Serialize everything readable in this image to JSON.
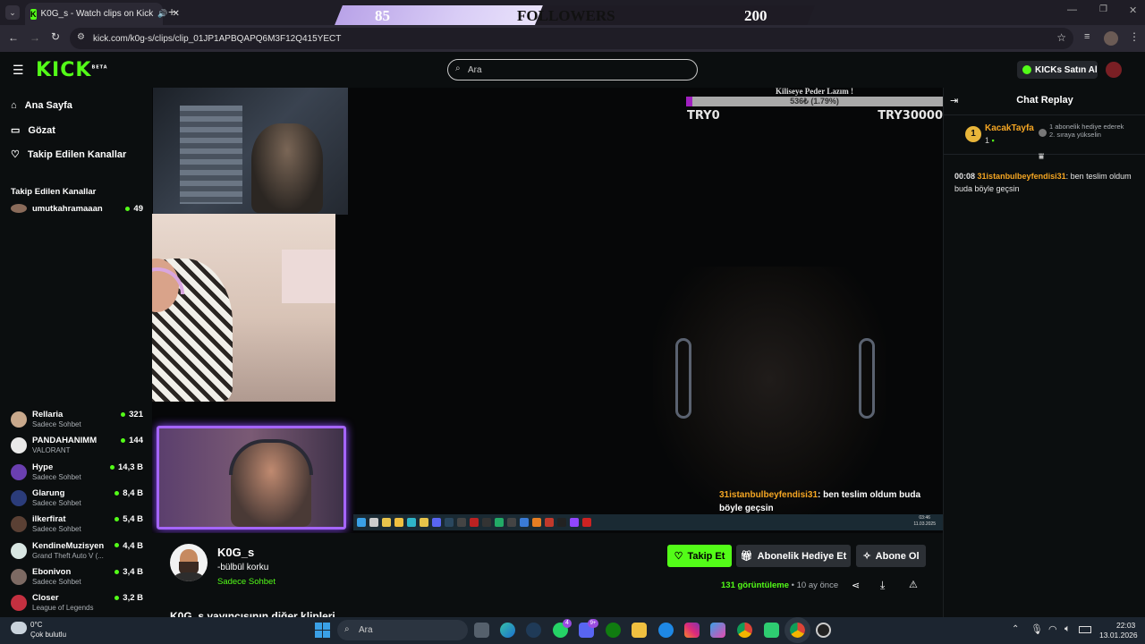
{
  "browser": {
    "tab_title": "K0G_s - Watch clips on Kick",
    "url": "kick.com/k0g-s/clips/clip_01JP1APBQAPQ6M3F12Q415YECT"
  },
  "followers_goal": {
    "current": "85",
    "label": "FOLLOWERS",
    "target": "200",
    "progress_fraction": 0.425
  },
  "header": {
    "logo": "KICK",
    "logo_badge": "BETA",
    "search_placeholder": "Ara",
    "kicks_button": "KICKs Satın Al"
  },
  "sidebar": {
    "nav": [
      {
        "label": "Ana Sayfa",
        "icon": "home-icon"
      },
      {
        "label": "Gözat",
        "icon": "browse-icon"
      },
      {
        "label": "Takip Edilen Kanallar",
        "icon": "heart-icon"
      }
    ],
    "followed_heading": "Takip Edilen Kanallar",
    "first_channel": {
      "name": "umutkahramaaan",
      "viewers": "49"
    },
    "channels": [
      {
        "name": "Rellaria",
        "category": "Sadece Sohbet",
        "viewers": "321",
        "color": "#c9a98c"
      },
      {
        "name": "PANDAHANIMM",
        "category": "VALORANT",
        "viewers": "144",
        "color": "#e9e9e9"
      },
      {
        "name": "Hype",
        "category": "Sadece Sohbet",
        "viewers": "14,3 B",
        "color": "#6a3fb0"
      },
      {
        "name": "Glarung",
        "category": "Sadece Sohbet",
        "viewers": "8,4 B",
        "color": "#2b3c7a"
      },
      {
        "name": "ilkerfirat",
        "category": "Sadece Sohbet",
        "viewers": "5,4 B",
        "color": "#5a4034"
      },
      {
        "name": "KendineMuzisyen",
        "category": "Grand Theft Auto V (...",
        "viewers": "4,4 B",
        "color": "#d8e6e2"
      },
      {
        "name": "Ebonivon",
        "category": "Sadece Sohbet",
        "viewers": "3,4 B",
        "color": "#7d6a63"
      },
      {
        "name": "Closer",
        "category": "League of Legends",
        "viewers": "3,2 B",
        "color": "#c43040"
      }
    ]
  },
  "stream_overlay": {
    "donation_title": "Kiliseye Peder Lazım !",
    "donation_value": "536₺ (1.79%)",
    "donation_fraction": 0.0179,
    "donation_min": "TRY0",
    "donation_max": "TRY30000",
    "chat_user": "31istanbulbeyfendisi31",
    "chat_message": ": ben teslim oldum buda böyle geçsin",
    "inner_clock_time": "03:46",
    "inner_clock_date": "11.03.2025"
  },
  "chat_panel": {
    "title": "Chat Replay",
    "gifter_rank": "1",
    "gifter_name": "KacakTayfa",
    "gifter_count": "1",
    "gifter_note": "1 abonelik hediye ederek 2. sıraya yükselin",
    "messages": [
      {
        "time": "00:08",
        "user": "31istanbulbeyfendisi31",
        "text": ": ben teslim oldum buda böyle geçsin"
      }
    ]
  },
  "channel_info": {
    "name": "K0G_s",
    "title": "-bülbül korku",
    "category": "Sadece Sohbet",
    "follow_button": "Takip Et",
    "gift_button": "Abonelik Hediye Et",
    "subscribe_button": "Abone Ol",
    "views_count": "131",
    "views_label": "görüntüleme",
    "age": "10 ay önce",
    "more_clips": "K0G_s yayıncısının diğer klipleri"
  },
  "taskbar": {
    "weather_temp": "0°C",
    "weather_desc": "Çok bulutlu",
    "search": "Ara",
    "time": "22:03",
    "date": "13.01.2026",
    "badge_whatsapp": "4",
    "badge_discord": "9+"
  },
  "colors": {
    "kick_green": "#53fc18",
    "username_orange": "#f5a623",
    "webcam_border": "#a565ff"
  }
}
